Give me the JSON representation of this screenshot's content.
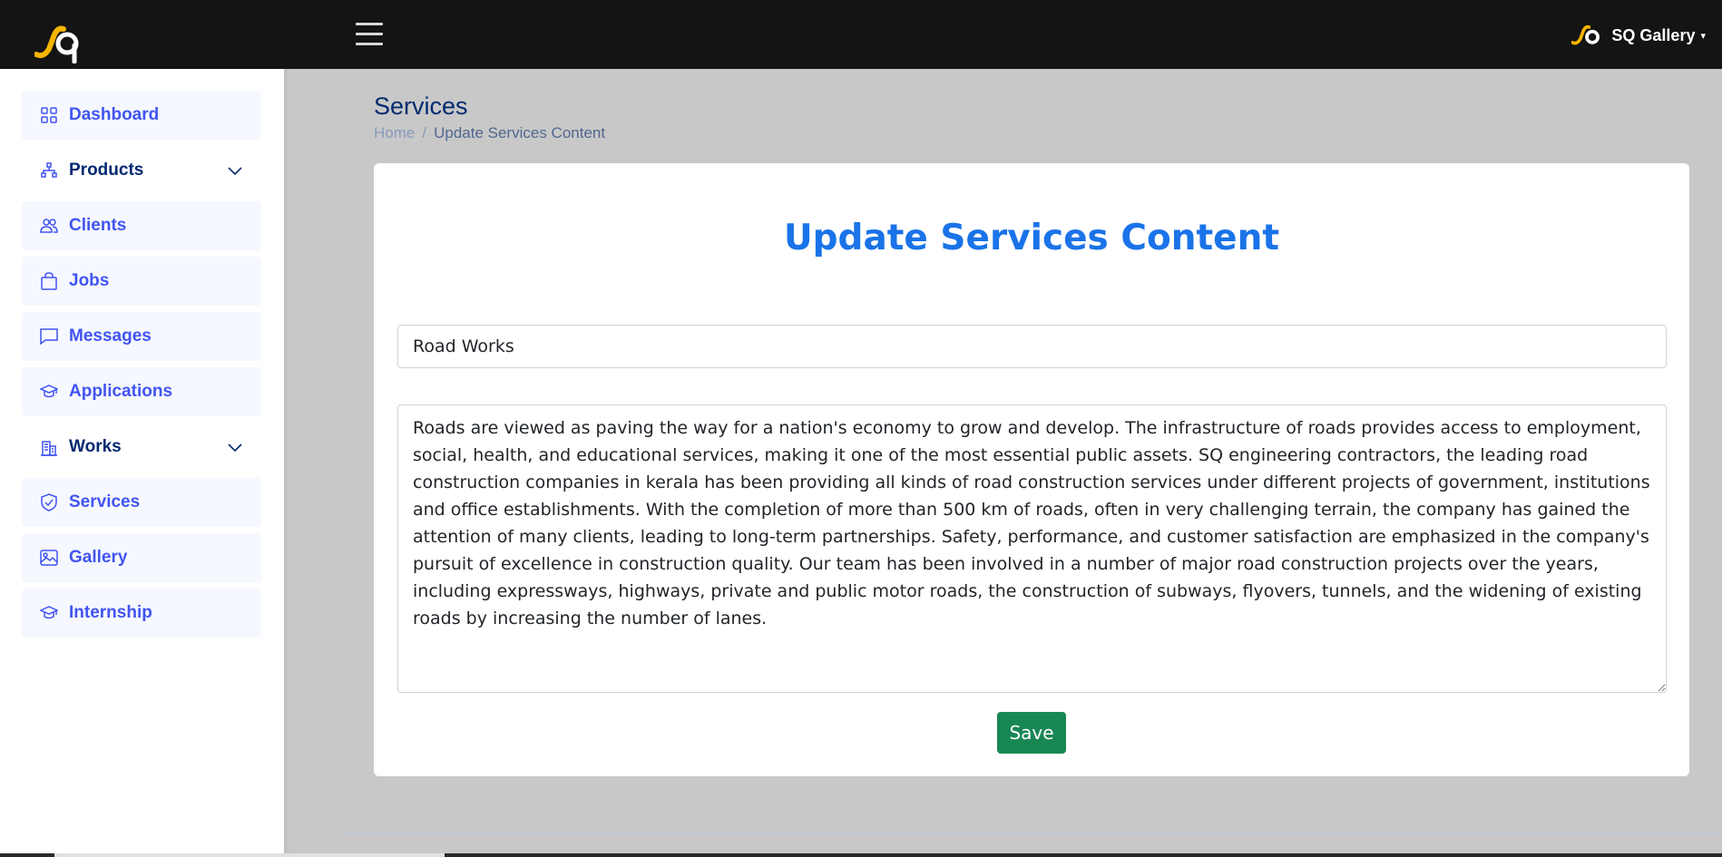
{
  "header": {
    "profile_name": "SQ Gallery",
    "caret": "▾",
    "accent": "#f5b400"
  },
  "sidebar": {
    "items": [
      {
        "label": "Dashboard",
        "icon": "grid-icon",
        "expandable": false
      },
      {
        "label": "Products",
        "icon": "diagram-icon",
        "expandable": true
      },
      {
        "label": "Clients",
        "icon": "people-icon",
        "expandable": false
      },
      {
        "label": "Jobs",
        "icon": "bag-icon",
        "expandable": false
      },
      {
        "label": "Messages",
        "icon": "chat-icon",
        "expandable": false
      },
      {
        "label": "Applications",
        "icon": "mortarboard-icon",
        "expandable": false
      },
      {
        "label": "Works",
        "icon": "building-icon",
        "expandable": true
      },
      {
        "label": "Services",
        "icon": "shield-check-icon",
        "expandable": false
      },
      {
        "label": "Gallery",
        "icon": "image-icon",
        "expandable": false
      },
      {
        "label": "Internship",
        "icon": "mortarboard-icon",
        "expandable": false
      }
    ]
  },
  "page": {
    "title": "Services",
    "breadcrumb": {
      "home": "Home",
      "separator": "/",
      "current": "Update Services Content"
    }
  },
  "form": {
    "heading": "Update Services Content",
    "title_value": "Road Works",
    "content_value": "Roads are viewed as paving the way for a nation's economy to grow and develop. The infrastructure of roads provides access to employment, social, health, and educational services, making it one of the most essential public assets. SQ engineering contractors, the leading road construction companies in kerala has been providing all kinds of road construction services under different projects of government, institutions and office establishments. With the completion of more than 500 km of roads, often in very challenging terrain, the company has gained the attention of many clients, leading to long-term partnerships. Safety, performance, and customer satisfaction are emphasized in the company's pursuit of excellence in construction quality. Our team has been involved in a number of major road construction projects over the years, including expressways, highways, private and public motor roads, the construction of subways, flyovers, tunnels, and the widening of existing roads by increasing the number of lanes.",
    "save_label": "Save"
  },
  "colors": {
    "primary": "#4154f1",
    "navy": "#012970",
    "heading_blue": "#1a73e8",
    "save_green": "#198754"
  }
}
